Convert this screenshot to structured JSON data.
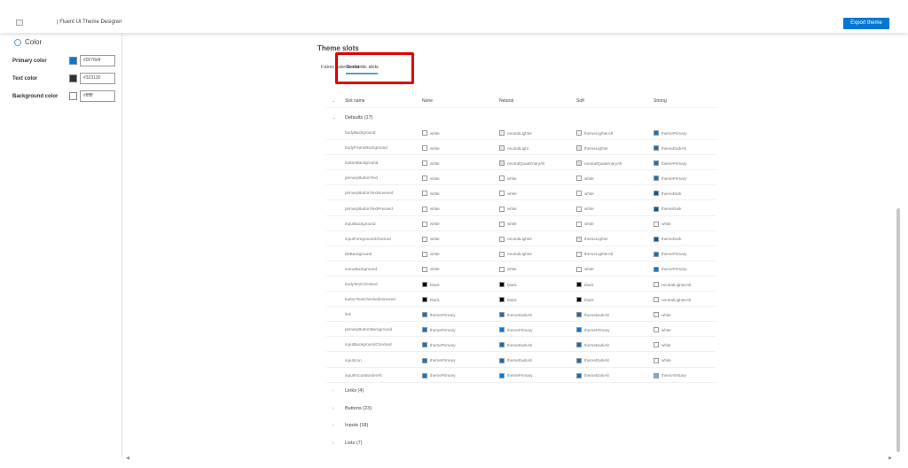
{
  "header": {
    "title": "| Fluent UI Theme Designer",
    "export_label": "Export theme"
  },
  "left": {
    "heading": "Color",
    "colors": [
      {
        "label": "Primary color",
        "value": "#0078d4",
        "swatch": "#0078d4"
      },
      {
        "label": "Text color",
        "value": "#323130",
        "swatch": "#323130"
      },
      {
        "label": "Background color",
        "value": "#ffffff",
        "swatch": "#ffffff"
      }
    ]
  },
  "main": {
    "title": "Theme slots",
    "tabs": [
      {
        "label": "Fabric palette slots"
      },
      {
        "label": "Semantic slots"
      }
    ],
    "columns": [
      "Slot name",
      "None",
      "Netural",
      "Soft",
      "Strong"
    ],
    "defaults_label": "Defaults (17)",
    "rows": [
      [
        "bodyBackground",
        "white",
        "neutralLighter",
        "themeLighterAlt",
        "themePrimary"
      ],
      [
        "bodyFrameBackground",
        "white",
        "neutralLight",
        "themeLighter",
        "themeDarkAlt"
      ],
      [
        "buttonBackground",
        "white",
        "neutralQuaternaryAlt",
        "neutralQuaternaryAlt",
        "themePrimary"
      ],
      [
        "primaryButtonText",
        "white",
        "white",
        "white",
        "themePrimary"
      ],
      [
        "primaryButtonTextHovered",
        "white",
        "white",
        "white",
        "themeDark"
      ],
      [
        "primaryButtonTextPressed",
        "white",
        "white",
        "white",
        "themeDark"
      ],
      [
        "inputBackground",
        "white",
        "white",
        "white",
        "white"
      ],
      [
        "inputForegroundChecked",
        "white",
        "neutralLighter",
        "themeLighter",
        "themeDark"
      ],
      [
        "listBackground",
        "white",
        "neutralLighter",
        "themeLighterAlt",
        "themePrimary"
      ],
      [
        "menuBackground",
        "white",
        "white",
        "white",
        "themePrimary"
      ],
      [
        "bodyTextChecked",
        "black",
        "black",
        "black",
        "neutralLighterAlt"
      ],
      [
        "buttonTextCheckedHovered",
        "black",
        "black",
        "black",
        "neutralLighterAlt"
      ],
      [
        "link",
        "themePrimary",
        "themeDarkAlt",
        "themeDarkAlt",
        "white"
      ],
      [
        "primaryButtonBackground",
        "themePrimary",
        "themePrimary",
        "themePrimary",
        "white"
      ],
      [
        "inputBackgroundChecked",
        "themePrimary",
        "themeDarkAlt",
        "themeDarkAlt",
        "white"
      ],
      [
        "inputIcon",
        "themePrimary",
        "themeDarkAlt",
        "themeDarkAlt",
        "white"
      ],
      [
        "inputFocusBorderAlt",
        "themePrimary",
        "themePrimary",
        "themeDarkAlt",
        "themeTertiary"
      ]
    ],
    "groups": [
      "Links (4)",
      "Buttons (23)",
      "Inputs (18)",
      "Lists (7)"
    ]
  },
  "swatch_colors": {
    "white": "#ffffff",
    "black": "#000000",
    "neutralLighter": "#f3f2f1",
    "neutralLight": "#edebe9",
    "neutralQuaternaryAlt": "#e1dfdd",
    "neutralLighterAlt": "#faf9f8",
    "themeLighterAlt": "#eff6fc",
    "themeLighter": "#deecf9",
    "themePrimary": "#0078d4",
    "themeDarkAlt": "#106ebe",
    "themeDark": "#005a9e",
    "themeTertiary": "#71afe5"
  }
}
